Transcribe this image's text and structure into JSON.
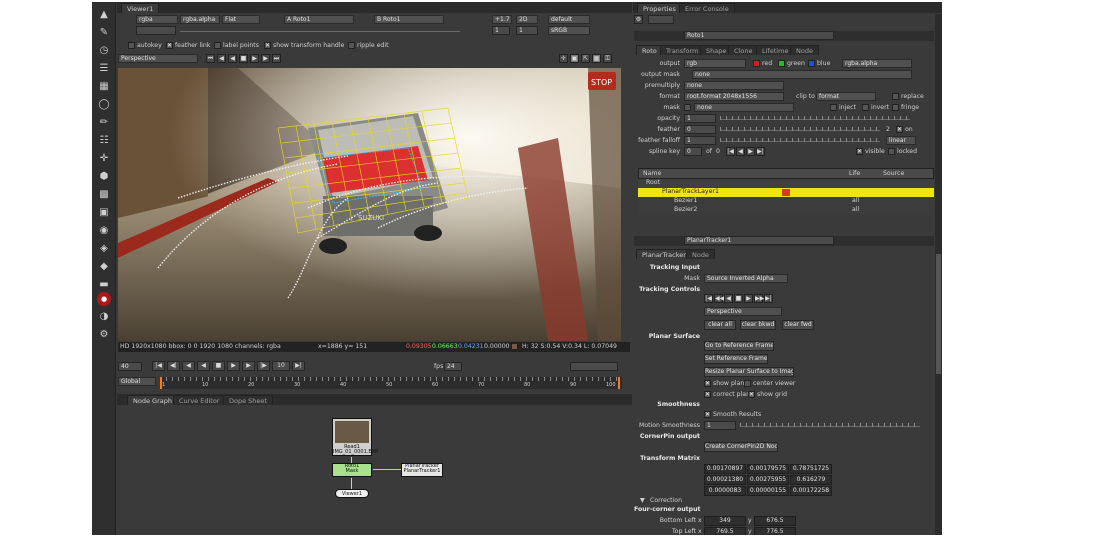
{
  "viewer": {
    "tab": "Viewer1",
    "channels": "rgba",
    "channel_alpha": "rgba.alpha",
    "display_mode": "Flat",
    "input_a": "A Roto1",
    "input_b": "B Roto1",
    "gain": "+1.7",
    "zoom_level": "2D",
    "lut": "default",
    "frame": "1",
    "gamma": "1",
    "colorspace": "sRGB",
    "toolbar_options": [
      "autokey",
      "feather link",
      "label points",
      "show transform handle",
      "ripple edit"
    ],
    "mode": "Perspective",
    "status_format": "HD 1920x1080 bbox: 0 0 1920 1080 channels: rgba",
    "status_coords": "x=1886 y= 151",
    "status_values": [
      "0.09305",
      "0.06663",
      "0.04231",
      "0.00000"
    ],
    "status_hsvl": "H: 32 S:0.54 V:0.34  L: 0.07049",
    "sign_text": "STOP",
    "frame_field": "40",
    "fps_label": "fps",
    "fps_value": "24",
    "step_value": "10",
    "range_mode": "Global",
    "ruler_labels": [
      "1",
      "10",
      "20",
      "30",
      "40",
      "50",
      "60",
      "70",
      "80",
      "90",
      "100"
    ]
  },
  "bottom_tabs": [
    "Node Graph",
    "Curve Editor",
    "Dope Sheet"
  ],
  "node_graph": {
    "read_node": "Read1",
    "read_sub": "IMG_01_0001.EXR",
    "roto_node": "Roto1",
    "roto_sub": "Mask",
    "planar_node": "PlanarTracker",
    "planar_sub": "PlanarTracker1",
    "viewer_node": "Viewer1"
  },
  "properties": {
    "tabs": [
      "Properties",
      "Error Console"
    ],
    "node_name": "Roto1",
    "subtabs": [
      "Roto",
      "Transform",
      "Shape",
      "Clone",
      "Lifetime",
      "Node"
    ],
    "output_label": "output",
    "output_value": "rgb",
    "channels_rgba": [
      "red",
      "green",
      "blue"
    ],
    "output_alpha": "rgba.alpha",
    "output_mask_label": "output mask",
    "output_mask_value": "none",
    "premultiply_label": "premultiply",
    "premultiply_value": "none",
    "format_label": "format",
    "format_value": "root.format 2048x1556",
    "clip_to_label": "clip to",
    "clip_to_value": "format",
    "replace_label": "replace",
    "mask_label": "mask",
    "mask_value": "none",
    "inject_label": "inject",
    "invert_label": "invert",
    "fringe_label": "fringe",
    "opacity_label": "opacity",
    "opacity_value": "1",
    "feather_label": "feather",
    "feather_value": "0",
    "feather_count": "2",
    "feather_on": "on",
    "feather_falloff_label": "feather falloff",
    "feather_falloff_value": "1",
    "feather_falloff_type": "linear",
    "spline_key_label": "spline key",
    "spline_key_value": "0",
    "spline_key_of": "of",
    "spline_key_total": "0",
    "visible_label": "visible",
    "locked_label": "locked",
    "tree_header_name": "Name",
    "tree_header_life": "Life",
    "tree_header_source": "Source",
    "tree_rows": [
      {
        "name": "Root",
        "life": "",
        "source": ""
      },
      {
        "name": "PlanarTrackLayer1",
        "life": "",
        "source": ""
      },
      {
        "name": "Bezier1",
        "life": "all",
        "source": ""
      },
      {
        "name": "Bezier2",
        "life": "all",
        "source": ""
      }
    ]
  },
  "planar": {
    "node_name": "PlanarTracker1",
    "subtabs": [
      "PlanarTracker",
      "Node"
    ],
    "tracking_input_label": "Tracking Input",
    "mask_label": "Mask",
    "mask_value": "Source Inverted Alpha",
    "tracking_controls_label": "Tracking Controls",
    "mode_value": "Perspective",
    "clear_buttons": [
      "clear all",
      "clear bkwd",
      "clear fwd"
    ],
    "planar_surface_label": "Planar Surface",
    "surface_buttons": [
      "Go to Reference Frame",
      "Set Reference Frame",
      "Resize Planar Surface to Image"
    ],
    "show_plane": "show plane",
    "center_viewer": "center viewer",
    "correct_plane": "correct plane",
    "show_grid": "show grid",
    "smoothness_label": "Smoothness",
    "smooth_results": "Smooth Results",
    "motion_smoothness_label": "Motion Smoothness",
    "motion_smoothness_value": "1",
    "cornerpin_label": "CornerPin output",
    "cornerpin_button": "Create CornerPin2D Node",
    "transform_matrix_label": "Transform Matrix",
    "matrix": [
      [
        "0.00170897",
        "0.00179575",
        "0.78751725"
      ],
      [
        "0.00021380",
        "0.00275955",
        "0.616279"
      ],
      [
        "0.0000083",
        "0.00000155",
        "0.00172258"
      ]
    ],
    "correction_label": "Correction",
    "four_corner_label": "Four-corner output",
    "bottom_left_label": "Bottom Left",
    "bottom_left": [
      "349",
      "676.5"
    ],
    "top_left_label": "Top Left",
    "top_left": [
      "769.5",
      "776.5"
    ]
  },
  "colors": {
    "selected_row": "#f2e50f",
    "roto_node": "#a8e08c",
    "red_overlay": "#e01818",
    "mesh_yellow": "#e8d81a"
  }
}
